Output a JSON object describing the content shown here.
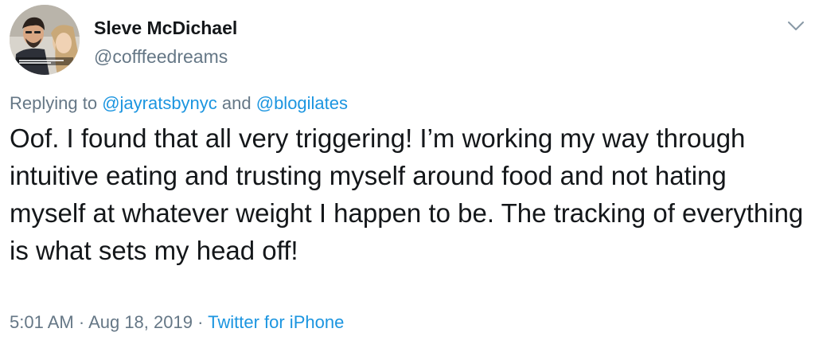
{
  "author": {
    "name": "Sleve McDichael",
    "handle": "@cofffeedreams",
    "avatar_icon": "profile-photo"
  },
  "menu": {
    "icon": "chevron-down-icon"
  },
  "reply": {
    "prefix": "Replying to ",
    "users": [
      "@jayratsbynyc",
      "@blogilates"
    ],
    "joiner": " and "
  },
  "tweet": {
    "text": "Oof. I found that all very triggering! I’m working my way through intuitive eating and trusting myself around food and not hating myself at whatever weight I happen to be. The tracking of everything is what sets my head off!"
  },
  "meta": {
    "time": "5:01 AM",
    "separator": " · ",
    "date": "Aug 18, 2019",
    "source": "Twitter for iPhone"
  },
  "colors": {
    "link": "#1b95e0",
    "secondary": "#657786",
    "primary": "#14171a"
  }
}
